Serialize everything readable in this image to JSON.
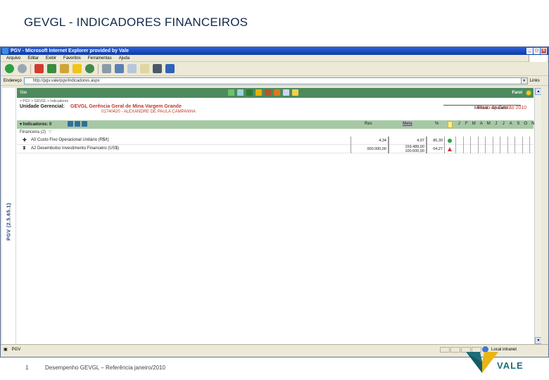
{
  "slide": {
    "title": "GEVGL - INDICADORES FINANCEIROS",
    "footer_number": "1",
    "footer_text": "Desempenho GEVGL – Referência janeiro/2010",
    "logo_text": "VALE"
  },
  "window": {
    "title": "PGV - Microsoft Internet Explorer provided by Vale",
    "menu": [
      "Arquivo",
      "Editar",
      "Exibir",
      "Favoritos",
      "Ferramentas",
      "Ajuda"
    ],
    "address_label": "Endereço",
    "address_value": "http://pgv.vale/pgv/indicadores.aspx",
    "links_label": "Links",
    "status_left": "PGV",
    "status_zone": "Local intranet"
  },
  "app": {
    "side_label": "PGV (2.5.65.1)",
    "bar_left": "Site",
    "farol_label": "Farol",
    "breadcrumb": "> PGV > GEVGL > Indicadores",
    "unit_label": "Unidade Gerencial:",
    "unit_code": "GEVGL",
    "unit_name": "Gerência Geral de Mina Vargem Grande",
    "unit_manager": "01740420 - ALEXANDRE DE PAULA CAMPANHA",
    "plano": "Plano de Gestão 2010",
    "mensal": "Mensal - Apurado",
    "indicators_label": "Indicadores: 0",
    "col_res": "Res",
    "col_meta": "Meta",
    "col_pct": "%",
    "months": [
      "J",
      "F",
      "M",
      "A",
      "M",
      "J",
      "J",
      "A",
      "S",
      "O",
      "N",
      "D"
    ],
    "group_label": "Financeira (2)",
    "rows": [
      {
        "mark": "✚",
        "name": "A0 Custo Fixo Operacional Unitário (R$/t)",
        "res": "4,34",
        "meta_line1": "4,97",
        "meta_line2": "",
        "pct": "86,39",
        "status": "green"
      },
      {
        "mark": "⧗",
        "name": "A2 Desembolso Investimento Financeiro (US$)",
        "res": "000.000,00",
        "meta_line1": "159.489,00",
        "meta_line2": "100.000,00",
        "pct": "04,27",
        "status": "red"
      }
    ]
  },
  "colors": {
    "appbar": "#4e8a5e",
    "header_band": "#a7c8a5",
    "titlebar": "#0b3aa8",
    "status_green": "#2ea44f",
    "status_red": "#d32f2f"
  }
}
